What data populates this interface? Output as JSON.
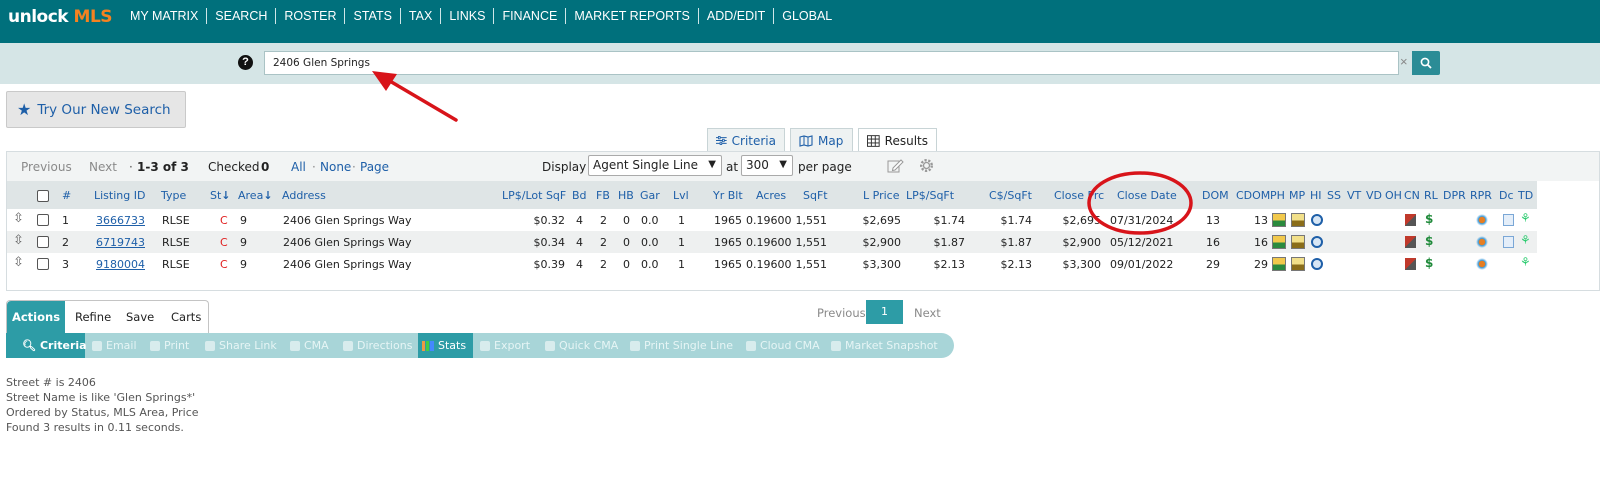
{
  "brand": {
    "part1": "unlock",
    "part2": "MLS"
  },
  "nav": [
    "MY MATRIX",
    "SEARCH",
    "ROSTER",
    "STATS",
    "TAX",
    "LINKS",
    "FINANCE",
    "MARKET REPORTS",
    "ADD/EDIT",
    "GLOBAL"
  ],
  "search": {
    "value": "2406 Glen Springs",
    "help": "?",
    "clear": "×"
  },
  "try_button": "Try Our New Search",
  "view_tabs": [
    "Criteria",
    "Map",
    "Results"
  ],
  "toolbar": {
    "previous": "Previous",
    "next": "Next",
    "range": "1-3 of 3",
    "checked_label": "Checked",
    "checked_count": "0",
    "all": "All",
    "none": "None",
    "page": "Page",
    "display_label": "Display",
    "display_value": "Agent Single Line",
    "at_label": "at",
    "per_value": "300",
    "per_page": "per page"
  },
  "columns": {
    "num": "#",
    "listing_id": "Listing ID",
    "type": "Type",
    "st": "St",
    "area": "Area",
    "address": "Address",
    "lp_lot": "LP$/Lot SqF",
    "bd": "Bd",
    "fb": "FB",
    "hb": "HB",
    "gar": "Gar",
    "lvl": "Lvl",
    "yr_blt": "Yr Blt",
    "acres": "Acres",
    "sqft": "SqFt",
    "l_price": "L Price",
    "lp_sqft": "LP$/SqFt",
    "c_sqft": "C$/SqFt",
    "close_prc": "Close Prc",
    "close_date": "Close Date",
    "dom": "DOM",
    "cdom": "CDOM",
    "ph": "PH",
    "mp": "MP",
    "hi": "HI",
    "ss": "SS",
    "vt": "VT",
    "vd": "VD",
    "oh": "OH",
    "cn": "CN",
    "rl": "RL",
    "dpr": "DPR",
    "rpr": "RPR",
    "dc": "Dc",
    "td": "TD"
  },
  "rows": [
    {
      "num": "1",
      "listing_id": "3666733",
      "type": "RLSE",
      "st": "C",
      "area": "9",
      "address": "2406 Glen Springs Way",
      "lp_lot": "$0.32",
      "bd": "4",
      "fb": "2",
      "hb": "0",
      "gar": "0.0",
      "lvl": "1",
      "yr_blt": "1965",
      "acres": "0.19600",
      "sqft": "1,551",
      "l_price": "$2,695",
      "lp_sqft": "$1.74",
      "c_sqft": "$1.74",
      "close_prc": "$2,695",
      "close_date": "07/31/2024",
      "dom": "13",
      "cdom": "13"
    },
    {
      "num": "2",
      "listing_id": "6719743",
      "type": "RLSE",
      "st": "C",
      "area": "9",
      "address": "2406 Glen Springs Way",
      "lp_lot": "$0.34",
      "bd": "4",
      "fb": "2",
      "hb": "0",
      "gar": "0.0",
      "lvl": "1",
      "yr_blt": "1965",
      "acres": "0.19600",
      "sqft": "1,551",
      "l_price": "$2,900",
      "lp_sqft": "$1.87",
      "c_sqft": "$1.87",
      "close_prc": "$2,900",
      "close_date": "05/12/2021",
      "dom": "16",
      "cdom": "16"
    },
    {
      "num": "3",
      "listing_id": "9180004",
      "type": "RLSE",
      "st": "C",
      "area": "9",
      "address": "2406 Glen Springs Way",
      "lp_lot": "$0.39",
      "bd": "4",
      "fb": "2",
      "hb": "0",
      "gar": "0.0",
      "lvl": "1",
      "yr_blt": "1965",
      "acres": "0.19600",
      "sqft": "1,551",
      "l_price": "$3,300",
      "lp_sqft": "$2.13",
      "c_sqft": "$2.13",
      "close_prc": "$3,300",
      "close_date": "09/01/2022",
      "dom": "29",
      "cdom": "29"
    }
  ],
  "action_tabs": [
    "Actions",
    "Refine",
    "Save",
    "Carts"
  ],
  "actions": [
    "Criteria",
    "Email",
    "Print",
    "Share Link",
    "CMA",
    "Directions",
    "Stats",
    "Export",
    "Quick CMA",
    "Print Single Line",
    "Cloud CMA",
    "Market Snapshot"
  ],
  "pager": {
    "previous": "Previous",
    "page": "1",
    "next": "Next"
  },
  "summary": [
    "Street # is 2406",
    "Street Name is like 'Glen Springs*'",
    "Ordered by Status, MLS Area, Price",
    "Found 3 results in 0.11 seconds."
  ],
  "colors": {
    "teal": "#00707c",
    "accent": "#2d9ca6",
    "link": "#1e5fa8",
    "orange": "#f58220",
    "annotation": "#d8141a"
  }
}
